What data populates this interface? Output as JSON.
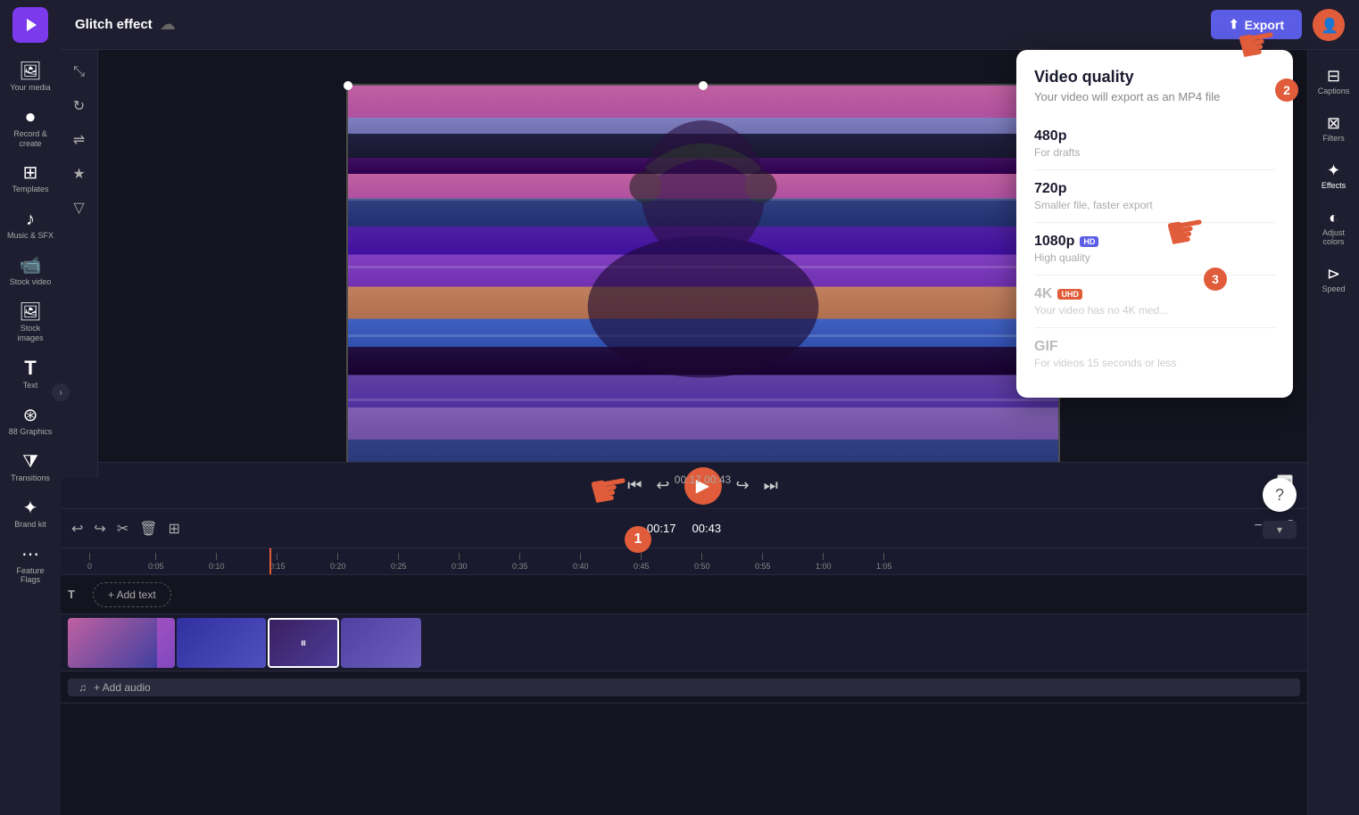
{
  "app": {
    "title": "Glitch effect",
    "logo_initial": "▶"
  },
  "topbar": {
    "title": "Glitch effect",
    "cloud_icon": "☁",
    "export_label": "Export",
    "export_icon": "⬆",
    "captions_label": "Captions"
  },
  "sidebar_left": {
    "items": [
      {
        "id": "your-media",
        "icon": "🖼",
        "label": "Your media"
      },
      {
        "id": "record-create",
        "icon": "⏺",
        "label": "Record &\ncreate"
      },
      {
        "id": "templates",
        "icon": "⊞",
        "label": "Templates"
      },
      {
        "id": "music-sfx",
        "icon": "♪",
        "label": "Music & SFX"
      },
      {
        "id": "stock-video",
        "icon": "📹",
        "label": "Stock video"
      },
      {
        "id": "stock-images",
        "icon": "🖼",
        "label": "Stock images"
      },
      {
        "id": "text",
        "icon": "T",
        "label": "Text"
      },
      {
        "id": "graphics",
        "icon": "⊛",
        "label": "88 Graphics"
      },
      {
        "id": "transitions",
        "icon": "⧩",
        "label": "Transitions"
      },
      {
        "id": "brand-kit",
        "icon": "✦",
        "label": "Brand kit"
      },
      {
        "id": "feature-flags",
        "icon": "⋯",
        "label": "Feature Flags"
      }
    ]
  },
  "sidebar_right": {
    "items": [
      {
        "id": "captions",
        "icon": "⊟",
        "label": "Captions"
      },
      {
        "id": "filters",
        "icon": "⊠",
        "label": "Filters"
      },
      {
        "id": "effects",
        "icon": "✦",
        "label": "Effects"
      },
      {
        "id": "adjust-colors",
        "icon": "◐",
        "label": "Adjust colors"
      },
      {
        "id": "speed",
        "icon": "⊳",
        "label": "Speed"
      }
    ]
  },
  "canvas_tools": [
    {
      "id": "crop",
      "icon": "⤡"
    },
    {
      "id": "rotate",
      "icon": "↻"
    },
    {
      "id": "flip",
      "icon": "⇌"
    },
    {
      "id": "ai",
      "icon": "★"
    }
  ],
  "quality_dropdown": {
    "title": "Video quality",
    "subtitle": "Your video will export as an MP4 file",
    "options": [
      {
        "id": "480p",
        "name": "480p",
        "desc": "For drafts",
        "badge": null,
        "disabled": false
      },
      {
        "id": "720p",
        "name": "720p",
        "desc": "Smaller file, faster export",
        "badge": null,
        "disabled": false
      },
      {
        "id": "1080p",
        "name": "1080p",
        "desc": "High quality",
        "badge": "HD",
        "badge_type": "hd",
        "disabled": false
      },
      {
        "id": "4k",
        "name": "4K",
        "desc": "Your video has no 4K med...",
        "badge": "UHD",
        "badge_type": "uhd",
        "disabled": true
      },
      {
        "id": "gif",
        "name": "GIF",
        "desc": "For videos 15 seconds or less",
        "badge": null,
        "disabled": true
      }
    ]
  },
  "playback": {
    "time_current": "00:17",
    "time_total": "00:43",
    "time_display": "00:17   00:43"
  },
  "timeline": {
    "current_time": "00:17",
    "total_time": "00:43",
    "add_text_label": "+ Add text",
    "add_audio_label": "+ Add audio",
    "ruler_marks": [
      "0",
      "0:05",
      "0:10",
      "0:15",
      "0:20",
      "0:25",
      "0:30",
      "0:35",
      "0:40",
      "0:45",
      "0:50",
      "0:55",
      "1:00",
      "1:05"
    ],
    "undo_icon": "↩",
    "redo_icon": "↪",
    "cut_icon": "✂",
    "delete_icon": "🗑",
    "duplicate_icon": "⊞",
    "zoom_out_icon": "−",
    "zoom_in_icon": "+",
    "fit_icon": "⤢"
  },
  "cursor_badges": {
    "badge1": "1",
    "badge2": "2",
    "badge3": "3"
  },
  "help": {
    "icon": "?"
  }
}
